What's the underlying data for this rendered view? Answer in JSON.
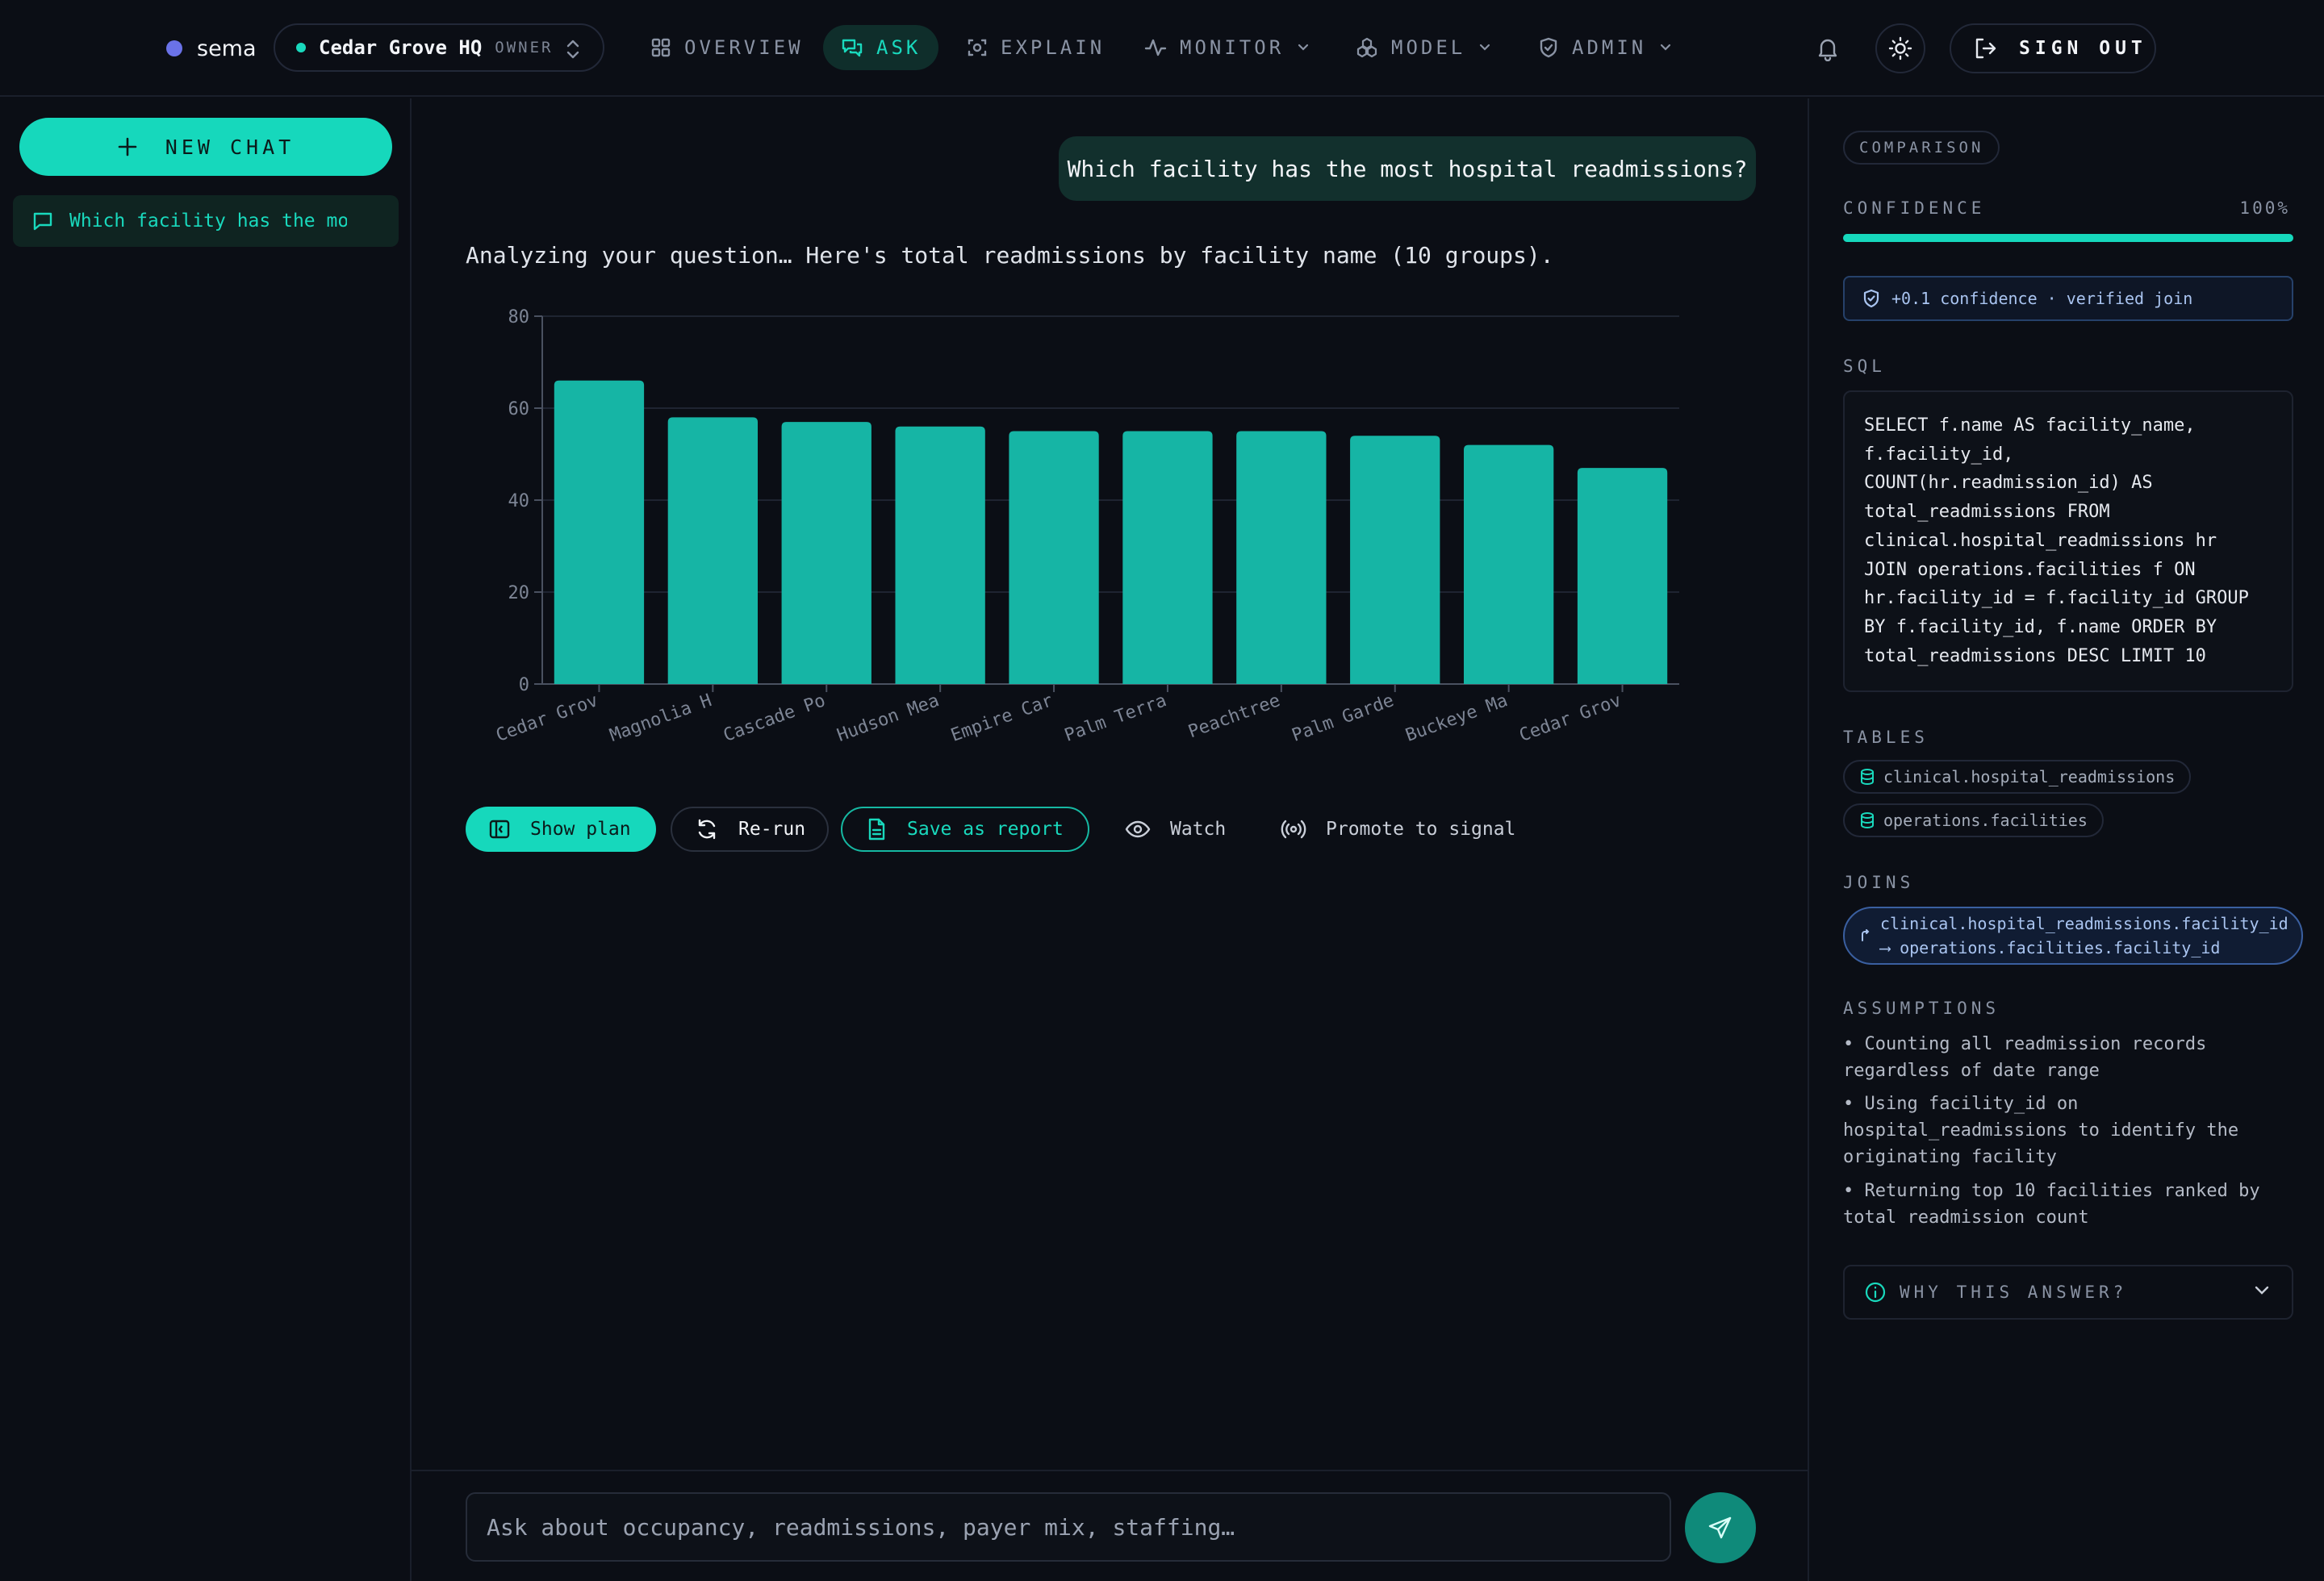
{
  "brand": {
    "name": "sema"
  },
  "org": {
    "name": "Cedar Grove HQ",
    "role": "OWNER"
  },
  "nav": {
    "overview": "OVERVIEW",
    "ask": "ASK",
    "explain": "EXPLAIN",
    "monitor": "MONITOR",
    "model": "MODEL",
    "admin": "ADMIN",
    "sign_out": "SIGN OUT"
  },
  "sidebar": {
    "new_chat": "NEW CHAT",
    "chats": [
      "Which facility has the most hospital readmissions?"
    ]
  },
  "conversation": {
    "user_question": "Which facility has the most hospital readmissions?",
    "answer_text": "Analyzing your question… Here's total readmissions by facility name (10 groups)."
  },
  "chart_data": {
    "type": "bar",
    "categories": [
      "Cedar Grov",
      "Magnolia H",
      "Cascade Po",
      "Hudson Mea",
      "Empire Car",
      "Palm Terra",
      "Peachtree",
      "Palm Garde",
      "Buckeye Ma",
      "Cedar Grov"
    ],
    "values": [
      66,
      58,
      57,
      56,
      55,
      55,
      55,
      54,
      52,
      47
    ],
    "yticks": [
      "0",
      "20",
      "40",
      "60",
      "80"
    ],
    "ylim": [
      0,
      80
    ],
    "grid": true,
    "bar_color": "#16b5a5"
  },
  "actions": {
    "show_plan": "Show plan",
    "rerun": "Re-run",
    "save_report": "Save as report",
    "watch": "Watch",
    "promote": "Promote to signal"
  },
  "composer": {
    "placeholder": "Ask about occupancy, readmissions, payer mix, staffing…"
  },
  "panel": {
    "tag": "COMPARISON",
    "confidence_label": "CONFIDENCE",
    "confidence_value": "100%",
    "confidence_fraction": 1.0,
    "verified_note": "+0.1 confidence · verified join",
    "sql_label": "SQL",
    "sql": "SELECT f.name AS facility_name,\nf.facility_id,\nCOUNT(hr.readmission_id) AS\ntotal_readmissions FROM\nclinical.hospital_readmissions hr\nJOIN operations.facilities f ON\nhr.facility_id = f.facility_id GROUP\nBY f.facility_id, f.name ORDER BY\ntotal_readmissions DESC LIMIT 10",
    "tables_label": "TABLES",
    "tables": [
      "clinical.hospital_readmissions",
      "operations.facilities"
    ],
    "joins_label": "JOINS",
    "join_from": "clinical.hospital_readmissions.facility_id",
    "join_to": "⟶ operations.facilities.facility_id",
    "assumptions_label": "ASSUMPTIONS",
    "assumptions": [
      "• Counting all readmission records regardless of date range",
      "• Using facility_id on hospital_readmissions to identify the originating facility",
      "• Returning top 10 facilities ranked by total readmission count"
    ],
    "why_label": "WHY THIS ANSWER?"
  },
  "colors": {
    "accent": "#16d8bc",
    "background": "#0b0e15",
    "join_blue": "#3a5fa0"
  }
}
